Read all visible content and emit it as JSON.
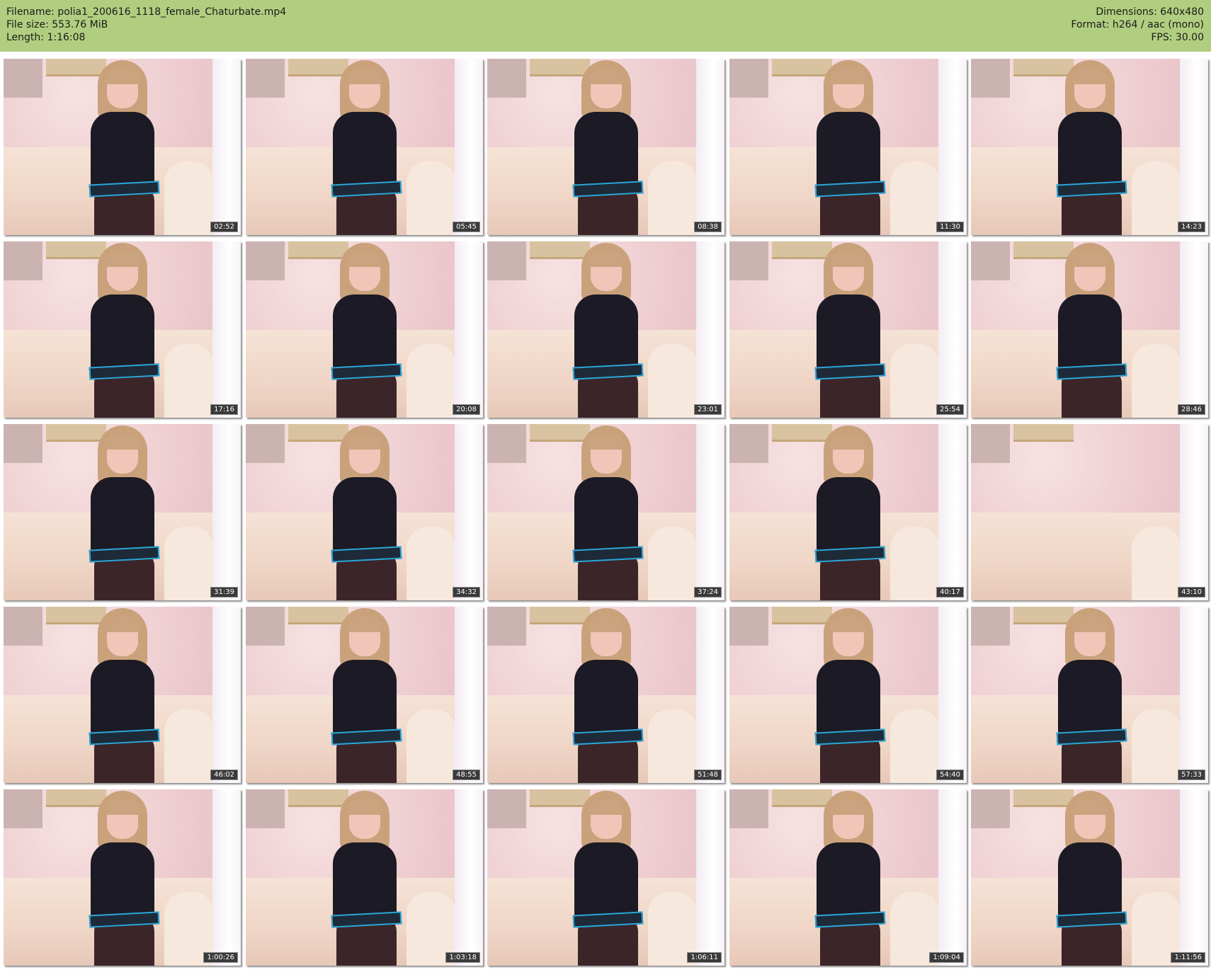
{
  "header": {
    "filename_label": "Filename:",
    "filename": "polia1_200616_1118_female_Chaturbate.mp4",
    "filesize_label": "File size:",
    "filesize": "553.76 MiB",
    "length_label": "Length:",
    "length": "1:16:08",
    "dimensions_label": "Dimensions:",
    "dimensions": "640x480",
    "format_label": "Format:",
    "format": "h264 / aac (mono)",
    "fps_label": "FPS:",
    "fps": "30.00",
    "background_color": "#b1ce80"
  },
  "thumbnails": [
    {
      "time": "02:52"
    },
    {
      "time": "05:45"
    },
    {
      "time": "08:38"
    },
    {
      "time": "11:30"
    },
    {
      "time": "14:23"
    },
    {
      "time": "17:16"
    },
    {
      "time": "20:08"
    },
    {
      "time": "23:01"
    },
    {
      "time": "25:54"
    },
    {
      "time": "28:46"
    },
    {
      "time": "31:39"
    },
    {
      "time": "34:32"
    },
    {
      "time": "37:24"
    },
    {
      "time": "40:17"
    },
    {
      "time": "43:10",
      "empty": true
    },
    {
      "time": "46:02"
    },
    {
      "time": "48:55"
    },
    {
      "time": "51:48"
    },
    {
      "time": "54:40"
    },
    {
      "time": "57:33"
    },
    {
      "time": "1:00:26"
    },
    {
      "time": "1:03:18"
    },
    {
      "time": "1:06:11"
    },
    {
      "time": "1:09:04"
    },
    {
      "time": "1:11:56"
    }
  ]
}
